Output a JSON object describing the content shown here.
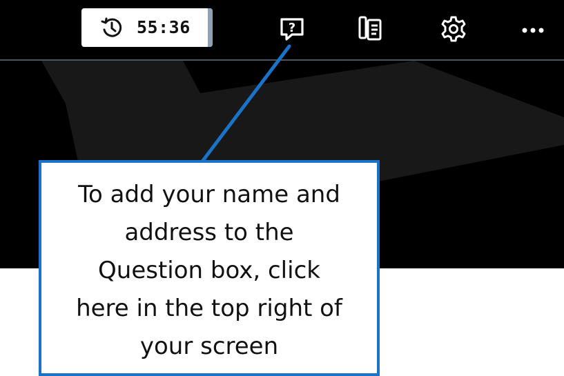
{
  "toolbar": {
    "timer": {
      "icon": "history-clock-icon",
      "value": "55:36"
    },
    "icons": [
      {
        "name": "question-icon",
        "glyph": "?"
      },
      {
        "name": "clipboard-list-icon"
      },
      {
        "name": "gear-icon"
      },
      {
        "name": "more-icon"
      }
    ]
  },
  "callout": {
    "lines": [
      "To add your name and",
      "address to the",
      "Question box, click",
      "here in the top right of",
      "your screen"
    ],
    "border_color": "#1a73c9"
  },
  "colors": {
    "background": "#000000",
    "timer_accent": "#8da2b6",
    "callout_border": "#1a73c9"
  }
}
